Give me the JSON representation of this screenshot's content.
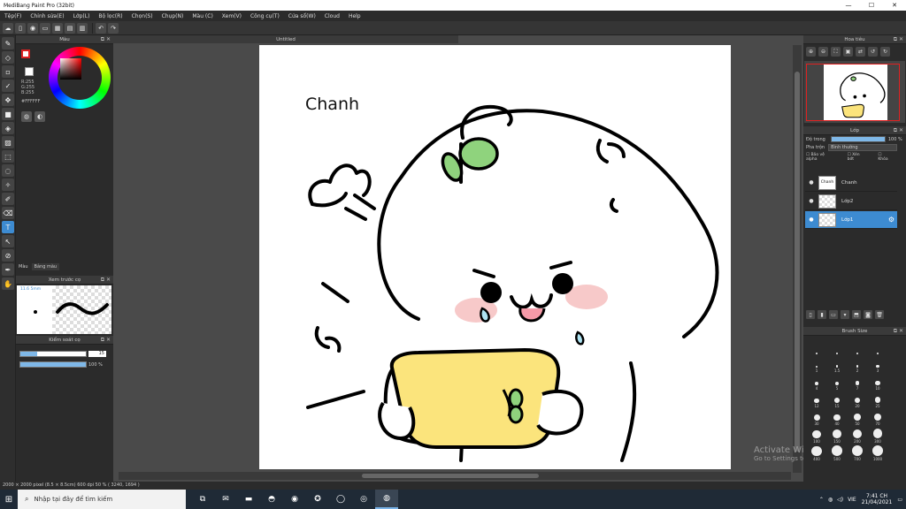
{
  "window": {
    "title": "MediBang Paint Pro (32bit)",
    "controls": [
      "—",
      "☐",
      "✕"
    ]
  },
  "menu": [
    "Tệp(F)",
    "Chỉnh sửa(E)",
    "Lớp(L)",
    "Bộ lọc(R)",
    "Chọn(S)",
    "Chụp(N)",
    "Màu (C)",
    "Xem(V)",
    "Công cụ(T)",
    "Cửa sổ(W)",
    "Cloud",
    "Help"
  ],
  "color_panel": {
    "title": "Màu",
    "r": "R:255",
    "g": "G:255",
    "b": "B:255",
    "hex": "#FFFFFF",
    "tabs": [
      "Màu",
      "Bảng màu"
    ],
    "primary_color": "#ffffff",
    "accent": "#3d8bd1"
  },
  "brush_preview": {
    "title": "Xem trước cọ",
    "size_label": "11.6 5mm"
  },
  "brush_control": {
    "title": "Kiểm soát cọ",
    "size_value": "15",
    "size_fraction": 0.25,
    "opacity_value": "100 %",
    "opacity_fraction": 1.0
  },
  "document": {
    "tab": "Untitled",
    "canvas_text": "Chanh"
  },
  "navigator": {
    "title": "Hoa tiêu"
  },
  "layers_panel": {
    "title": "Lớp",
    "opacity_label": "Độ trong",
    "opacity_value": "100 %",
    "blend_label": "Pha trộn",
    "blend_value": "Bình thường",
    "checks": [
      "Bảo vệ alpha",
      "Xén bớt",
      "Khóa"
    ],
    "layers": [
      {
        "name": "Chanh",
        "thumb": "Chanh",
        "selected": false
      },
      {
        "name": "Lớp2",
        "thumb": "",
        "selected": false
      },
      {
        "name": "Lớp1",
        "thumb": "",
        "selected": true
      }
    ]
  },
  "brush_size": {
    "title": "Brush Size",
    "cells": [
      {
        "label": "",
        "v": 1
      },
      {
        "label": "",
        "v": 1
      },
      {
        "label": "",
        "v": 1
      },
      {
        "label": "",
        "v": 1
      },
      {
        "label": "1",
        "v": 1
      },
      {
        "label": "1.5",
        "v": 1.5
      },
      {
        "label": "2",
        "v": 2
      },
      {
        "label": "3",
        "v": 3
      },
      {
        "label": "4",
        "v": 4
      },
      {
        "label": "5",
        "v": 5
      },
      {
        "label": "7",
        "v": 7
      },
      {
        "label": "10",
        "v": 10
      },
      {
        "label": "12",
        "v": 12
      },
      {
        "label": "15",
        "v": 15
      },
      {
        "label": "20",
        "v": 20
      },
      {
        "label": "25",
        "v": 25
      },
      {
        "label": "30",
        "v": 30
      },
      {
        "label": "40",
        "v": 40
      },
      {
        "label": "50",
        "v": 50
      },
      {
        "label": "70",
        "v": 70
      },
      {
        "label": "100",
        "v": 100
      },
      {
        "label": "150",
        "v": 150
      },
      {
        "label": "200",
        "v": 200
      },
      {
        "label": "300",
        "v": 300
      },
      {
        "label": "400",
        "v": 400
      },
      {
        "label": "500",
        "v": 500
      },
      {
        "label": "700",
        "v": 700
      },
      {
        "label": "1000",
        "v": 1000
      }
    ]
  },
  "status": {
    "text": "2000 × 2000 pixel  (8.5 × 8.5cm)  600 dpi  50 %  ( 3240, 1694 )"
  },
  "watermark": {
    "line1": "Activate Windows",
    "line2": "Go to Settings to activate Windows."
  },
  "taskbar": {
    "search_placeholder": "Nhập tại đây để tìm kiếm",
    "tray_lang": "VIE",
    "time": "7:41 CH",
    "date": "21/04/2021"
  }
}
